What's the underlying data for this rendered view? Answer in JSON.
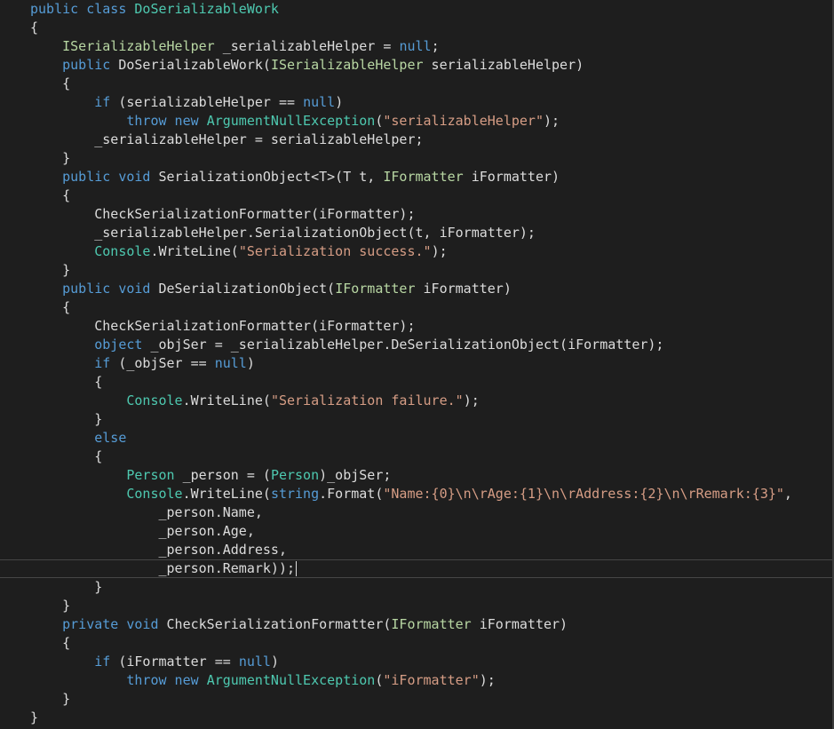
{
  "editor": {
    "theme": {
      "background": "#1e1e1e",
      "keyword": "#569cd6",
      "type": "#4ec9b0",
      "interface": "#b8d7a3",
      "string": "#d69d85",
      "plain": "#dcdcdc"
    },
    "lines": [
      [
        [
          "k",
          "public class "
        ],
        [
          "t",
          "DoSerializableWork"
        ]
      ],
      [
        [
          "p",
          "{"
        ]
      ],
      [
        [
          "p",
          "    "
        ],
        [
          "i",
          "ISerializableHelper"
        ],
        [
          "p",
          " _serializableHelper = "
        ],
        [
          "k",
          "null"
        ],
        [
          "p",
          ";"
        ]
      ],
      [
        [
          "p",
          "    "
        ],
        [
          "k",
          "public "
        ],
        [
          "p",
          "DoSerializableWork("
        ],
        [
          "i",
          "ISerializableHelper"
        ],
        [
          "p",
          " serializableHelper)"
        ]
      ],
      [
        [
          "p",
          "    {"
        ]
      ],
      [
        [
          "p",
          "        "
        ],
        [
          "k",
          "if"
        ],
        [
          "p",
          " (serializableHelper == "
        ],
        [
          "k",
          "null"
        ],
        [
          "p",
          ")"
        ]
      ],
      [
        [
          "p",
          "            "
        ],
        [
          "k",
          "throw new "
        ],
        [
          "t",
          "ArgumentNullException"
        ],
        [
          "p",
          "("
        ],
        [
          "s",
          "\"serializableHelper\""
        ],
        [
          "p",
          ");"
        ]
      ],
      [
        [
          "p",
          "        _serializableHelper = serializableHelper;"
        ]
      ],
      [
        [
          "p",
          "    }"
        ]
      ],
      [
        [
          "p",
          "    "
        ],
        [
          "k",
          "public void "
        ],
        [
          "p",
          "SerializationObject<T>(T t, "
        ],
        [
          "i",
          "IFormatter"
        ],
        [
          "p",
          " iFormatter)"
        ]
      ],
      [
        [
          "p",
          "    {"
        ]
      ],
      [
        [
          "p",
          "        CheckSerializationFormatter(iFormatter);"
        ]
      ],
      [
        [
          "p",
          "        _serializableHelper.SerializationObject(t, iFormatter);"
        ]
      ],
      [
        [
          "p",
          "        "
        ],
        [
          "t",
          "Console"
        ],
        [
          "p",
          ".WriteLine("
        ],
        [
          "s",
          "\"Serialization success.\""
        ],
        [
          "p",
          ");"
        ]
      ],
      [
        [
          "p",
          "    }"
        ]
      ],
      [
        [
          "p",
          "    "
        ],
        [
          "k",
          "public void "
        ],
        [
          "p",
          "DeSerializationObject("
        ],
        [
          "i",
          "IFormatter"
        ],
        [
          "p",
          " iFormatter)"
        ]
      ],
      [
        [
          "p",
          "    {"
        ]
      ],
      [
        [
          "p",
          "        CheckSerializationFormatter(iFormatter);"
        ]
      ],
      [
        [
          "p",
          "        "
        ],
        [
          "k",
          "object"
        ],
        [
          "p",
          " _objSer = _serializableHelper.DeSerializationObject(iFormatter);"
        ]
      ],
      [
        [
          "p",
          "        "
        ],
        [
          "k",
          "if"
        ],
        [
          "p",
          " (_objSer == "
        ],
        [
          "k",
          "null"
        ],
        [
          "p",
          ")"
        ]
      ],
      [
        [
          "p",
          "        {"
        ]
      ],
      [
        [
          "p",
          "            "
        ],
        [
          "t",
          "Console"
        ],
        [
          "p",
          ".WriteLine("
        ],
        [
          "s",
          "\"Serialization failure.\""
        ],
        [
          "p",
          ");"
        ]
      ],
      [
        [
          "p",
          "        }"
        ]
      ],
      [
        [
          "p",
          "        "
        ],
        [
          "k",
          "else"
        ]
      ],
      [
        [
          "p",
          "        {"
        ]
      ],
      [
        [
          "p",
          "            "
        ],
        [
          "t",
          "Person"
        ],
        [
          "p",
          " _person = ("
        ],
        [
          "t",
          "Person"
        ],
        [
          "p",
          ")_objSer;"
        ]
      ],
      [
        [
          "p",
          "            "
        ],
        [
          "t",
          "Console"
        ],
        [
          "p",
          ".WriteLine("
        ],
        [
          "k",
          "string"
        ],
        [
          "p",
          ".Format("
        ],
        [
          "s",
          "\"Name:{0}\\n\\rAge:{1}\\n\\rAddress:{2}\\n\\rRemark:{3}\""
        ],
        [
          "p",
          ","
        ]
      ],
      [
        [
          "p",
          "                _person.Name,"
        ]
      ],
      [
        [
          "p",
          "                _person.Age,"
        ]
      ],
      [
        [
          "p",
          "                _person.Address,"
        ]
      ],
      [
        [
          "p",
          "                _person.Remark));"
        ]
      ],
      [
        [
          "p",
          "        }"
        ]
      ],
      [
        [
          "p",
          "    }"
        ]
      ],
      [
        [
          "p",
          "    "
        ],
        [
          "k",
          "private void "
        ],
        [
          "p",
          "CheckSerializationFormatter("
        ],
        [
          "i",
          "IFormatter"
        ],
        [
          "p",
          " iFormatter)"
        ]
      ],
      [
        [
          "p",
          "    {"
        ]
      ],
      [
        [
          "p",
          "        "
        ],
        [
          "k",
          "if"
        ],
        [
          "p",
          " (iFormatter == "
        ],
        [
          "k",
          "null"
        ],
        [
          "p",
          ")"
        ]
      ],
      [
        [
          "p",
          "            "
        ],
        [
          "k",
          "throw new "
        ],
        [
          "t",
          "ArgumentNullException"
        ],
        [
          "p",
          "("
        ],
        [
          "s",
          "\"iFormatter\""
        ],
        [
          "p",
          ");"
        ]
      ],
      [
        [
          "p",
          "    }"
        ]
      ],
      [
        [
          "p",
          "}"
        ]
      ]
    ],
    "current_line": 30
  }
}
